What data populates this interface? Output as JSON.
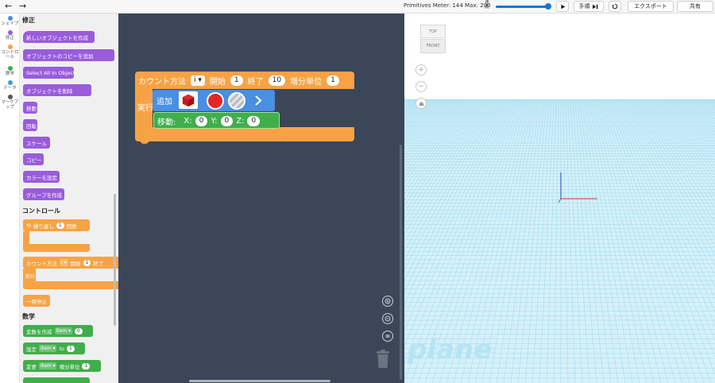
{
  "topbar": {
    "undo_icon": "undo-arrow-icon",
    "redo_icon": "redo-arrow-icon",
    "meter_text": "Primitives Meter: 144 Max: 200",
    "speed_label": "速度",
    "speed_value": 0.95,
    "play_icon": "play-icon",
    "step_label": "手順",
    "reset_icon": "reset-icon",
    "export_label": "エクスポート",
    "share_label": "共有"
  },
  "rail": {
    "items": [
      {
        "label": "シェイプ",
        "color": "#4a90e2"
      },
      {
        "label": "修正",
        "color": "#9a5cdb"
      },
      {
        "label": "コントロール",
        "color": "#f7a345"
      },
      {
        "label": "数学",
        "color": "#3fae4b"
      },
      {
        "label": "データ",
        "color": "#2fa3d6"
      },
      {
        "label": "マーケアップ",
        "color": "#555555"
      }
    ]
  },
  "flyout": {
    "sections": {
      "modify": "修正",
      "control": "コントロール",
      "math": "数学"
    },
    "modify_blocks": {
      "create_object": "新しいオブジェクトを作成",
      "add_copy": "オブジェクトのコピーを追加",
      "select_all": "Select All In Object",
      "delete_object": "オブジェクトを削除",
      "move": "移動",
      "rotate": "回転",
      "scale": "スケール",
      "copy": "コピー",
      "set_color": "カラーを設定",
      "create_group": "グループを作成"
    },
    "control_blocks": {
      "repeat": "繰り返し",
      "repeat_count": "1",
      "repeat_unit": "回数",
      "count_with": "カウント方法",
      "count_var": "i",
      "count_from": "開始",
      "count_from_val": "1",
      "count_to": "終了",
      "count_do": "実行",
      "pause": "一時停止"
    },
    "math_blocks": {
      "create_var": "変数を作成",
      "create_var_name": "item",
      "create_var_val": "0",
      "set": "設定",
      "set_var": "item",
      "set_to": "to",
      "set_val": "1",
      "change": "変更",
      "change_var": "item",
      "change_by": "増分単位",
      "change_val": "1"
    }
  },
  "workspace": {
    "loop": {
      "label": "カウント方法",
      "var": "i",
      "from_label": "開始",
      "from": "1",
      "to_label": "終了",
      "to": "10",
      "step_label": "増分単位",
      "step": "1",
      "do_label": "実行"
    },
    "add_block": {
      "label": "追加",
      "shape_icon": "red-cube-icon",
      "color": "#e52629",
      "color_icon": "red-color-swatch-icon",
      "material_icon": "striped-material-icon",
      "expand_icon": "chevron-right-icon"
    },
    "move_block": {
      "label": "移動:",
      "x_label": "X:",
      "x": "0",
      "y_label": "Y:",
      "y": "0",
      "z_label": "Z:",
      "z": "0"
    },
    "zoom_in_icon": "zoom-in-icon",
    "zoom_out_icon": "zoom-out-icon",
    "zoom_reset_icon": "zoom-reset-icon",
    "trash_icon": "trash-icon"
  },
  "viewport": {
    "view_cube_top": "TOP",
    "view_cube_front": "FRONT",
    "zoom_in_icon": "plus-icon",
    "zoom_out_icon": "minus-icon",
    "home_icon": "home-icon",
    "grid_watermark": "plane",
    "grid_color": "#a6dcef"
  }
}
